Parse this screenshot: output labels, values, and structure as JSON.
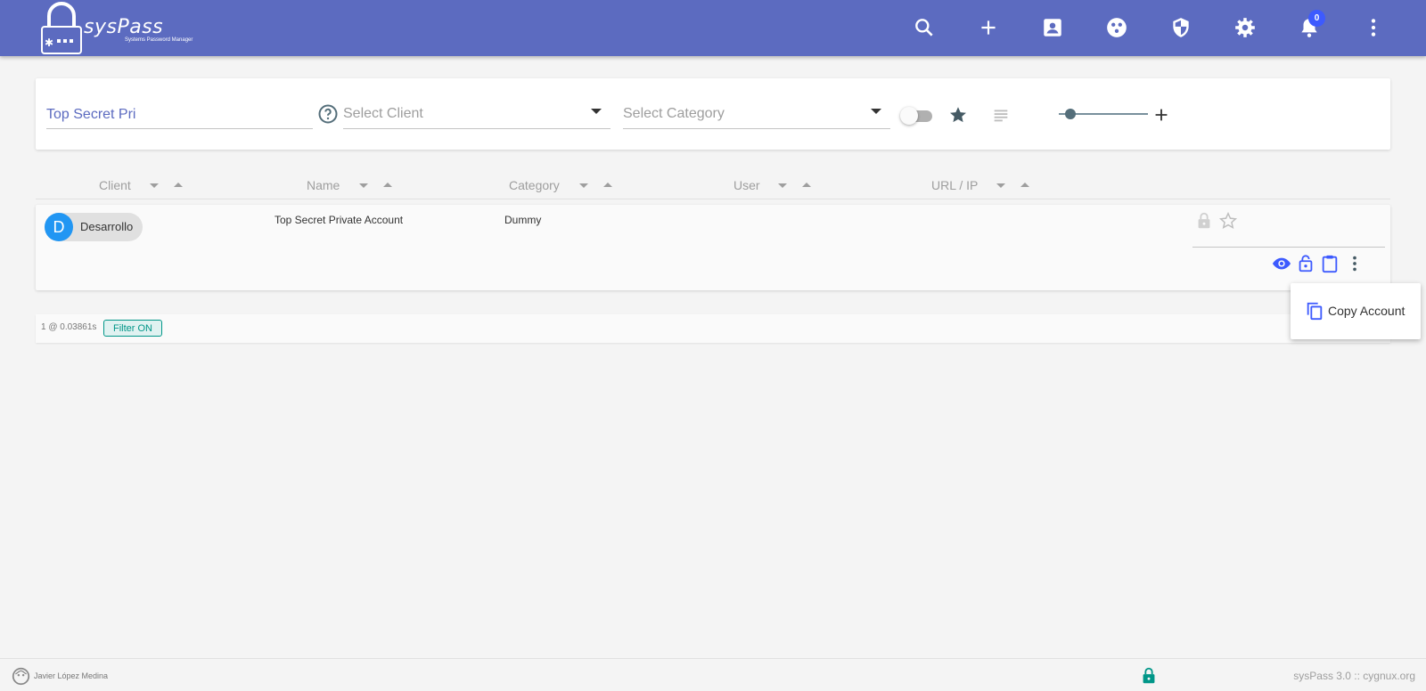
{
  "header": {
    "logo_title": "sysPass",
    "logo_subtitle": "Systems Password Manager",
    "icons": [
      "search-icon",
      "plus-icon",
      "account-box-icon",
      "apps-icon",
      "security-icon",
      "gear-icon",
      "bell-icon",
      "more-vert-icon"
    ],
    "notification_count": "0",
    "background_color": "#5c6bc0"
  },
  "search": {
    "value": "Top Secret Pri",
    "client_placeholder": "Select Client",
    "category_placeholder": "Select Category"
  },
  "table": {
    "columns": [
      "Client",
      "Name",
      "Category",
      "User",
      "URL / IP"
    ]
  },
  "account": {
    "client_initial": "D",
    "client": "Desarrollo",
    "name": "Top Secret Private Account",
    "category": "Dummy",
    "user": "",
    "url": ""
  },
  "popup_menu": {
    "item": "Copy Account"
  },
  "status": {
    "results": "1 @ 0.03861s",
    "filter": "Filter ON"
  },
  "footer": {
    "user_name": "Javier López Medina",
    "app_info": "sysPass 3.0  ::  cygnux.org"
  },
  "colors": {
    "primary": "#5c6bc0",
    "accent_blue": "#3d5afe",
    "teal": "#009688",
    "avatar_blue": "#2196f3"
  }
}
